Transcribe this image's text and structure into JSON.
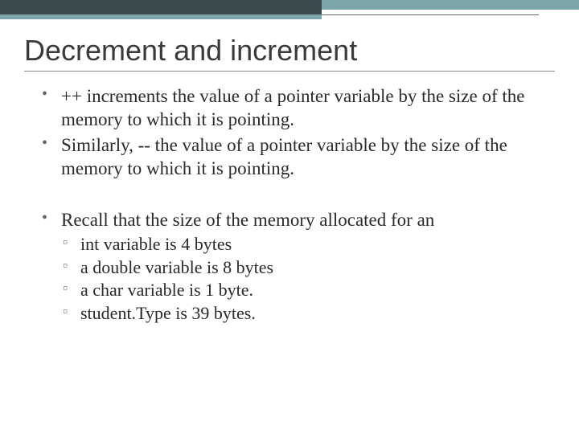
{
  "title": "Decrement and increment",
  "bullets": {
    "b1": "++ increments the value of a pointer variable by the size of the memory to which it is pointing.",
    "b2": "Similarly, --  the value of a pointer variable by the size of the memory to which it is pointing.",
    "b3": "Recall that the size of the memory allocated for an",
    "sub": {
      "s1": " int variable is 4 bytes",
      "s2": "a double variable is 8 bytes",
      "s3": "a char variable is 1 byte.",
      "s4": "student.Type is 39 bytes."
    }
  }
}
